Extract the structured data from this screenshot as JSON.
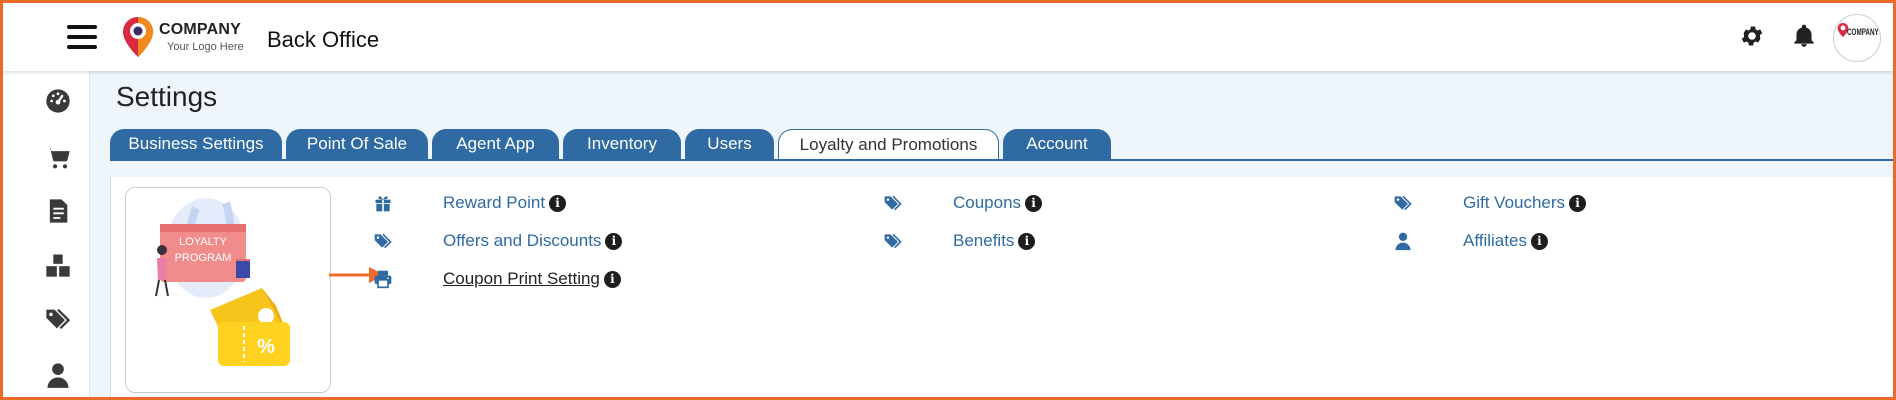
{
  "header": {
    "logo_name": "COMPANY",
    "logo_tagline": "Your Logo Here",
    "app_title": "Back Office",
    "avatar_text": "COMPANY",
    "icons": [
      "menu-icon",
      "gear-icon",
      "bell-icon"
    ]
  },
  "sidebar": {
    "items": [
      {
        "icon": "dashboard-icon"
      },
      {
        "icon": "cart-icon"
      },
      {
        "icon": "document-icon"
      },
      {
        "icon": "boxes-icon"
      },
      {
        "icon": "tags-icon"
      },
      {
        "icon": "user-icon"
      }
    ]
  },
  "page": {
    "title": "Settings"
  },
  "tabs": [
    {
      "label": "Business Settings",
      "active": false
    },
    {
      "label": "Point Of Sale",
      "active": false
    },
    {
      "label": "Agent App",
      "active": false
    },
    {
      "label": "Inventory",
      "active": false
    },
    {
      "label": "Users",
      "active": false
    },
    {
      "label": "Loyalty and Promotions",
      "active": true
    },
    {
      "label": "Account",
      "active": false
    }
  ],
  "illustration": {
    "banner_line1": "LOYALTY",
    "banner_line2": "PROGRAM",
    "coupon_symbol": "%"
  },
  "settings_items": [
    {
      "label": "Reward Point",
      "icon": "gift-icon"
    },
    {
      "label": "Coupons",
      "icon": "tags-icon"
    },
    {
      "label": "Gift Vouchers",
      "icon": "tags-icon"
    },
    {
      "label": "Offers and Discounts",
      "icon": "tags-icon"
    },
    {
      "label": "Benefits",
      "icon": "tags-icon"
    },
    {
      "label": "Affiliates",
      "icon": "user-icon"
    },
    {
      "label": "Coupon Print Setting",
      "icon": "printer-icon"
    }
  ],
  "info_glyph": "i",
  "colors": {
    "accent": "#2f6aa2",
    "annotation": "#ee6a2a",
    "content_bg": "#eef5fb"
  }
}
